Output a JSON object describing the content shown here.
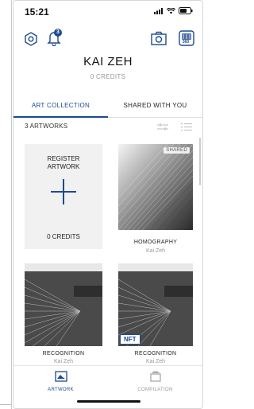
{
  "status_bar": {
    "time": "15:21"
  },
  "profile": {
    "name": "KAI ZEH",
    "credits": "0 CREDITS"
  },
  "tabs": [
    {
      "label": "ART COLLECTION",
      "active": true
    },
    {
      "label": "SHARED WITH YOU",
      "active": false
    }
  ],
  "collection": {
    "count_label": "3 ARTWORKS"
  },
  "register_card": {
    "title_line1": "REGISTER",
    "title_line2": "ARTWORK",
    "credits": "0 CREDITS"
  },
  "artworks": [
    {
      "title": "HOMOGRAPHY",
      "artist": "Kai Zeh",
      "badge": "SHARED"
    },
    {
      "title": "RECOGNITION",
      "artist": "Kai Zeh",
      "badge": ""
    },
    {
      "title": "RECOGNITION",
      "artist": "Kai Zeh",
      "badge": "NFT"
    }
  ],
  "bottom_nav": [
    {
      "label": "ARTWORK",
      "icon": "artwork-icon",
      "active": true
    },
    {
      "label": "COMPILATION",
      "icon": "compilation-icon",
      "active": false
    }
  ],
  "notification_count": "3",
  "badge_360": "360",
  "colors": {
    "accent": "#1c4a8e",
    "muted": "#999999"
  },
  "icons": [
    "settings-icon",
    "bell-icon",
    "camera-icon",
    "scan-360-icon",
    "filter-icon",
    "list-view-icon",
    "wifi-icon",
    "battery-icon",
    "signal-icon"
  ]
}
